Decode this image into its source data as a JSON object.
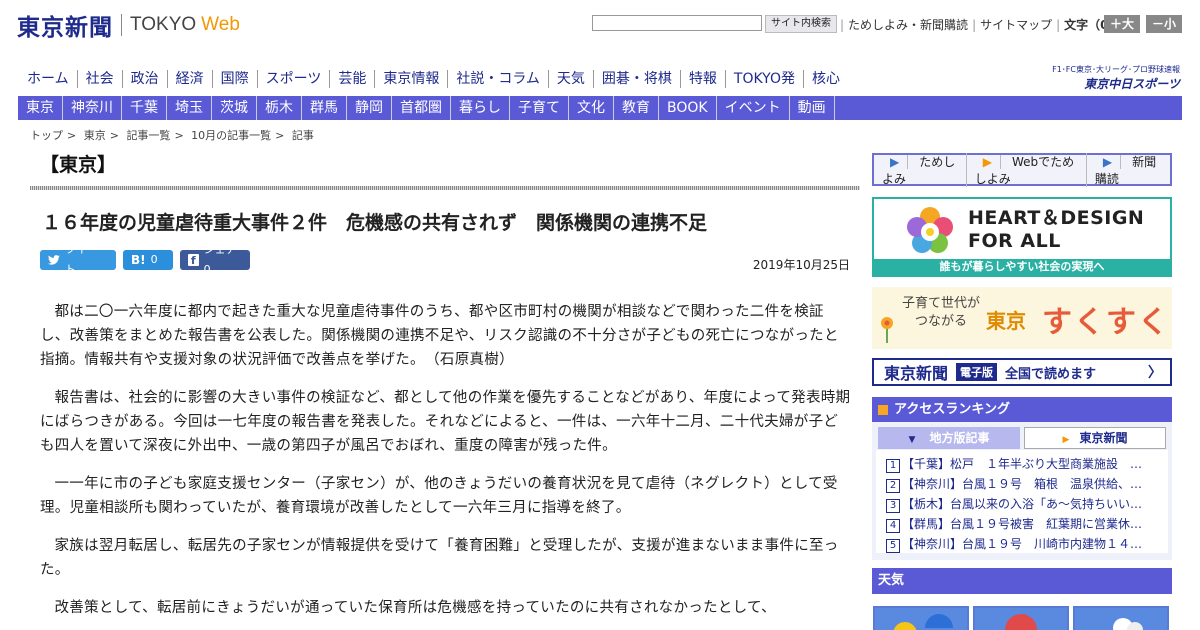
{
  "header": {
    "logo_jp": "東京新聞",
    "logo_tokyo": "TOKYO",
    "logo_web": "Web",
    "search_button": "サイト内検索",
    "links": [
      "ためしよみ・新聞購読",
      "サイトマップ"
    ],
    "font_size_label": "文字（0）",
    "font_plus": "＋大",
    "font_minus": "－小"
  },
  "nav1": [
    "ホーム",
    "社会",
    "政治",
    "経済",
    "国際",
    "スポーツ",
    "芸能",
    "東京情報",
    "社説・コラム",
    "天気",
    "囲碁・将棋",
    "特報",
    "TOKYO発",
    "核心"
  ],
  "chunichi": {
    "top": "F1･FC東京･大リーグ･プロ野球速報",
    "bottom": "東京中日スポーツ"
  },
  "nav2": [
    "東京",
    "神奈川",
    "千葉",
    "埼玉",
    "茨城",
    "栃木",
    "群馬",
    "静岡",
    "首都圏",
    "暮らし",
    "子育て",
    "文化",
    "教育",
    "BOOK",
    "イベント",
    "動画"
  ],
  "breadcrumb": [
    "トップ",
    "東京",
    "記事一覧",
    "10月の記事一覧",
    "記事"
  ],
  "article": {
    "region": "【東京】",
    "headline": "１６年度の児童虐待重大事件２件　危機感の共有されず　関係機関の連携不足",
    "share": {
      "tweet": "ツイート",
      "hatena": "0",
      "facebook": "シェア 0"
    },
    "date": "2019年10月25日",
    "paragraphs": [
      "都は二〇一六年度に都内で起きた重大な児童虐待事件のうち、都や区市町村の機関が相談などで関わった二件を検証し、改善策をまとめた報告書を公表した。関係機関の連携不足や、リスク認識の不十分さが子どもの死亡につながったと指摘。情報共有や支援対象の状況評価で改善点を挙げた。　（石原真樹）",
      "報告書は、社会的に影響の大きい事件の検証など、都として他の作業を優先することなどがあり、年度によって発表時期にばらつきがある。今回は一七年度の報告書を発表した。それなどによると、一件は、一六年十二月、二十代夫婦が子ども四人を置いて深夜に外出中、一歳の第四子が風呂でおぼれ、重度の障害が残った件。",
      "一一年に市の子ども家庭支援センター（子家セン）が、他のきょうだいの養育状況を見て虐待（ネグレクト）として受理。児童相談所も関わっていたが、養育環境が改善したとして一六年三月に指導を終了。",
      "家族は翌月転居し、転居先の子家センが情報提供を受けて「養育困難」と受理したが、支援が進まないまま事件に至った。",
      "改善策として、転居前にきょうだいが通っていた保育所は危機感を持っていたのに共有されなかったとして、"
    ]
  },
  "sidebar": {
    "tameshi": [
      "ためしよみ",
      "Webでためしよみ",
      "新聞購読"
    ],
    "heart_title_1": "HEART＆DESIGN",
    "heart_title_2": "FOR ALL",
    "heart_sub": "誰もが暮らしやすい社会の実現へ",
    "suku_small_1": "子育て世代が",
    "suku_small_2": "つながる",
    "suku_tokyo": "東京",
    "suku_big": "すくすく",
    "denshi_logo": "東京新聞",
    "denshi_tag": "電子版",
    "denshi_text": "全国で読めます",
    "ranking_title": "アクセスランキング",
    "ranking_tab1": "地方版記事",
    "ranking_tab2": "東京新聞",
    "ranking_items": [
      "【千葉】松戸　１年半ぶり大型商業施設　…",
      "【神奈川】台風１９号　箱根　温泉供給、…",
      "【栃木】台風以来の入浴「あ～気持ちいい…",
      "【群馬】台風１９号被害　紅葉期に営業休…",
      "【神奈川】台風１９号　川崎市内建物１４…"
    ],
    "weather_title": "天気"
  },
  "colors": {
    "brand_navy": "#1e2a8c",
    "nav_purple": "#5a5ad6",
    "accent_orange": "#f39800",
    "teal": "#2bb1a3"
  }
}
